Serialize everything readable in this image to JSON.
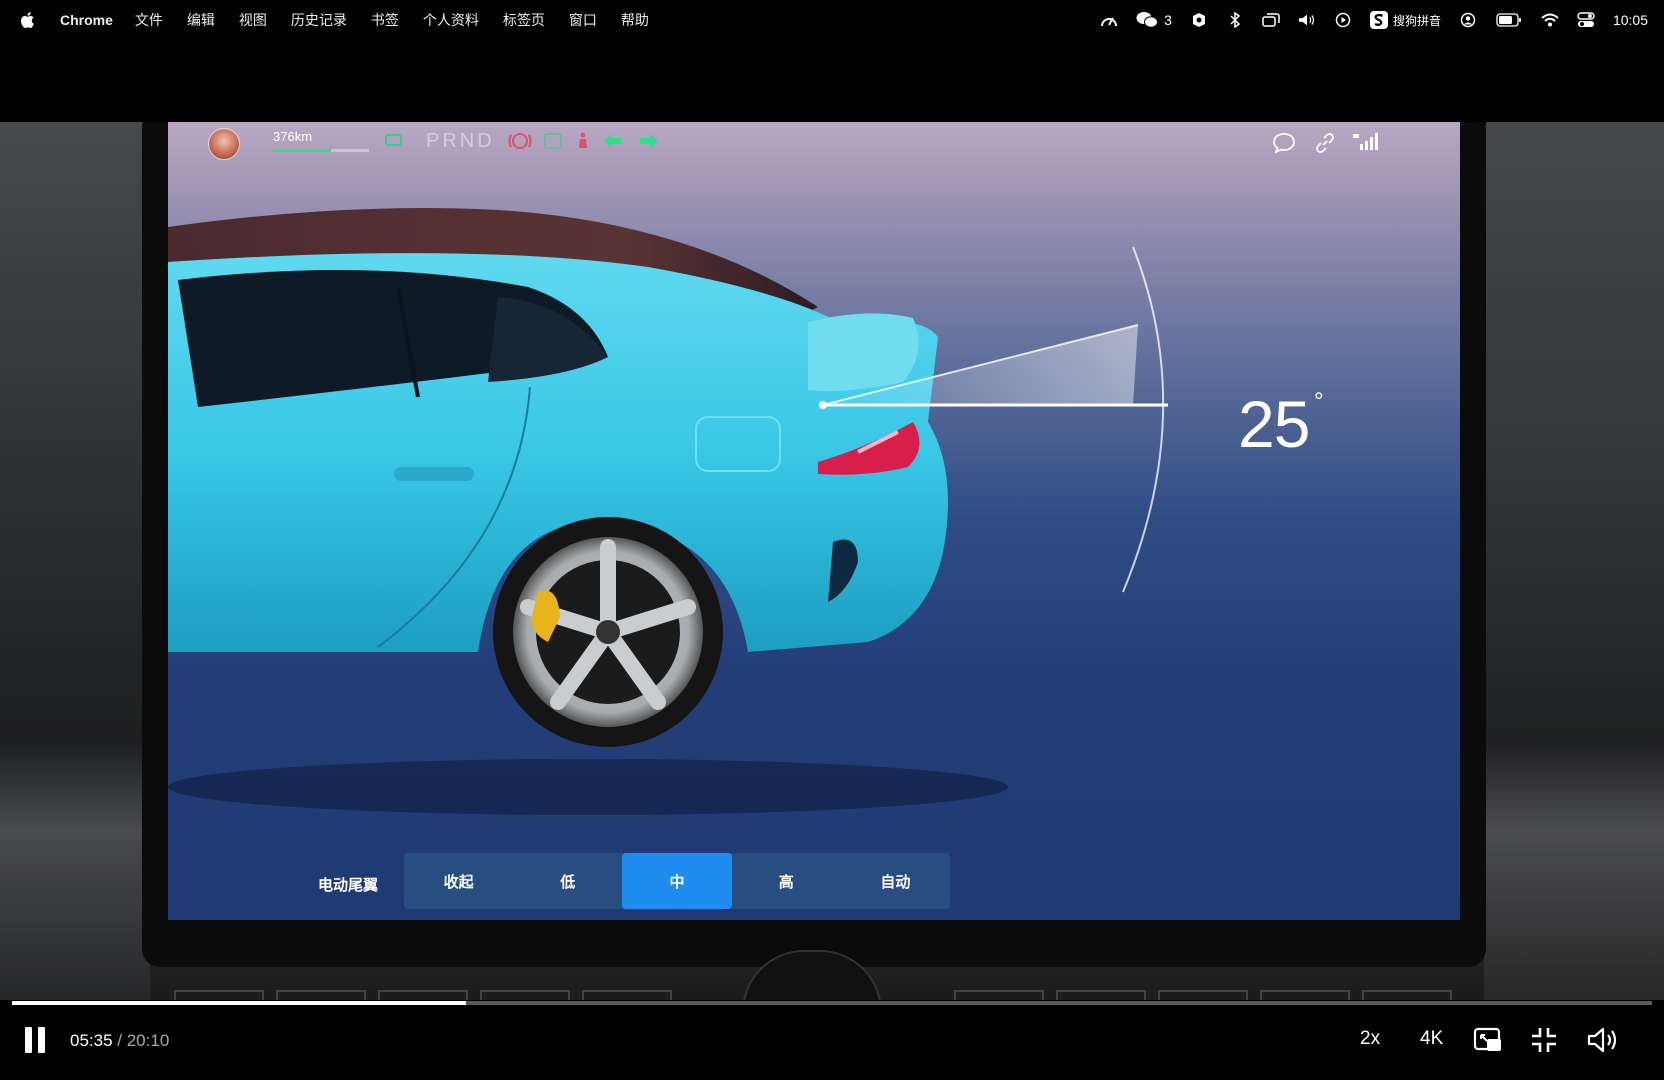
{
  "menubar": {
    "app_name": "Chrome",
    "items": [
      "文件",
      "编辑",
      "视图",
      "历史记录",
      "书签",
      "个人资料",
      "标签页",
      "窗口",
      "帮助"
    ],
    "wechat_count": "3",
    "input_method": "搜狗拼音",
    "clock": "10:05"
  },
  "car_screen": {
    "range": "376km",
    "range_fraction": 0.6,
    "gears": "PRND",
    "spoiler_angle": "25",
    "angle_unit": "°",
    "spoiler_label": "电动尾翼",
    "spoiler_options": [
      "收起",
      "低",
      "中",
      "高",
      "自动"
    ],
    "spoiler_selected": "中"
  },
  "player": {
    "current_time": "05:35",
    "duration": "/ 20:10",
    "progress_fraction": 0.277,
    "speed": "2x",
    "quality": "4K"
  },
  "colors": {
    "car_body": "#39c7e6",
    "accent_blue": "#1e8cf0",
    "range_bar": "#2fe08a"
  }
}
